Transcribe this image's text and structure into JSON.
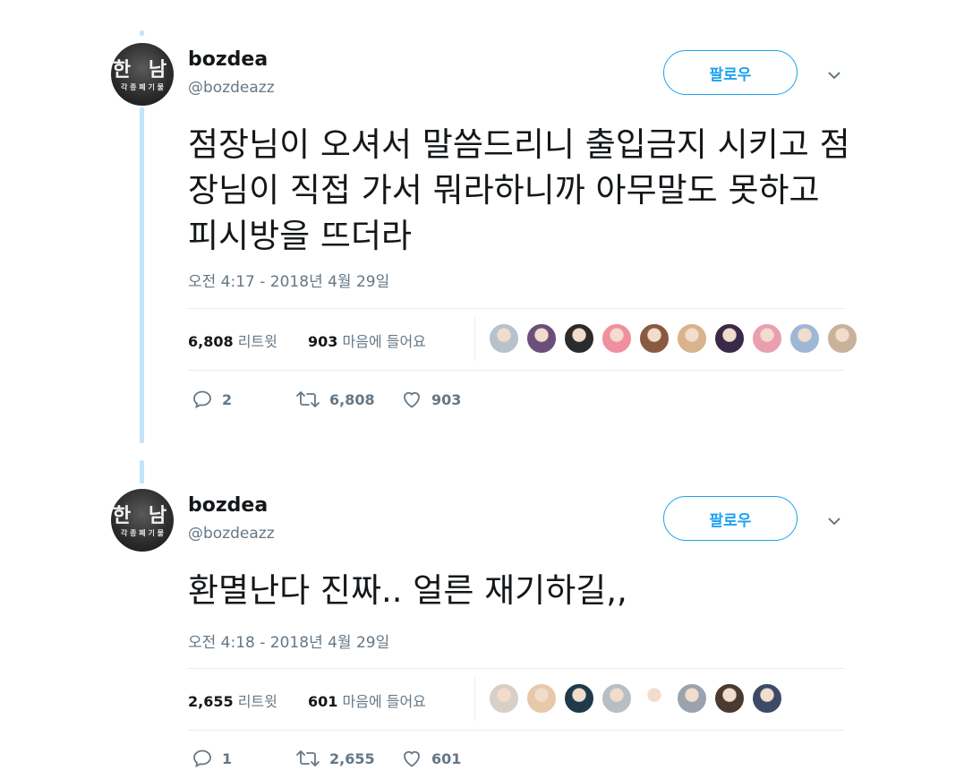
{
  "tweets": [
    {
      "name": "bozdea",
      "handle": "@bozdeazz",
      "avatar_text": "한 남",
      "avatar_subtext": "각 종 폐 기 물",
      "follow_label": "팔로우",
      "text": "점장님이 오셔서 말씀드리니 출입금지 시키고 점장님이  직접 가서 뭐라하니까 아무말도 못하고 피시방을 뜨더라",
      "timestamp": "오전 4:17 - 2018년 4월 29일",
      "retweets_count": "6,808",
      "retweets_label": "리트윗",
      "likes_count": "903",
      "likes_label": "마음에 들어요",
      "replies": "2",
      "retweets": "6,808",
      "likes": "903",
      "liker_colors": [
        "#b8c2cc",
        "#6b4f7a",
        "#2b2b2b",
        "#f08fa0",
        "#8a5a40",
        "#d9b38c",
        "#3a2a4a",
        "#e8a0b0",
        "#9fb7d6",
        "#c9b29a"
      ]
    },
    {
      "name": "bozdea",
      "handle": "@bozdeazz",
      "avatar_text": "한 남",
      "avatar_subtext": "각 종 폐 기 물",
      "follow_label": "팔로우",
      "text": "환멸난다 진짜.. 얼른 재기하길,,",
      "timestamp": "오전 4:18 - 2018년 4월 29일",
      "retweets_count": "2,655",
      "retweets_label": "리트윗",
      "likes_count": "601",
      "likes_label": "마음에 들어요",
      "replies": "1",
      "retweets": "2,655",
      "likes": "601",
      "liker_colors": [
        "#d8cfc6",
        "#e6c9a8",
        "#1f3a4a",
        "#b7bfc4",
        "#ffffff",
        "#9aa3ad",
        "#4a3a30",
        "#3c4a66"
      ]
    }
  ],
  "colors": {
    "accent": "#1da1f2",
    "thread_line": "#c4e4fb",
    "muted_text": "#657786",
    "divider": "#e6ecf0"
  },
  "icons": {
    "reply": "reply-icon",
    "retweet": "retweet-icon",
    "like": "heart-icon",
    "more": "chevron-down-icon"
  }
}
